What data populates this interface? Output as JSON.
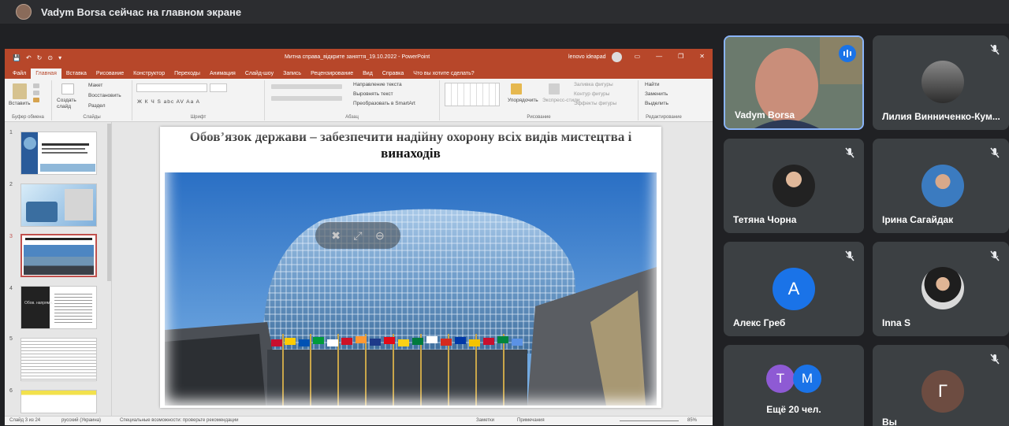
{
  "header": {
    "presenter_status": "Vadym Borsa сейчас на главном экране"
  },
  "powerpoint": {
    "window_title": "Митна справа_відкрите заняття_19.10.2022  -  PowerPoint",
    "user": "lenovo ideapad",
    "quick_access": [
      "💾",
      "↶",
      "↻",
      "⊙",
      "▾"
    ],
    "window_buttons": [
      "▭",
      "—",
      "❐",
      "✕"
    ],
    "tabs": [
      "Файл",
      "Главная",
      "Вставка",
      "Рисование",
      "Конструктор",
      "Переходы",
      "Анимация",
      "Слайд-шоу",
      "Запись",
      "Рецензирование",
      "Вид",
      "Справка"
    ],
    "tell_me": "Что вы хотите сделать?",
    "ribbon": {
      "paste": "Вставить",
      "new_slide": "Создать слайд",
      "layout": "Макет",
      "reset": "Восстановить",
      "section": "Раздел",
      "text_direction": "Направление текста",
      "align_text": "Выровнять текст",
      "smartart": "Преобразовать в SmartArt",
      "arrange": "Упорядочить",
      "quick_styles": "Экспресс-стили",
      "shape_fill": "Заливка фигуры",
      "shape_outline": "Контур фигуры",
      "shape_effects": "Эффекты фигуры",
      "find": "Найти",
      "replace": "Заменить",
      "select": "Выделить",
      "font_buttons": "Ж  К  Ч  S  abc  AV  Aa  A",
      "groups": {
        "clipboard": "Буфер обмена",
        "slides": "Слайды",
        "font": "Шрифт",
        "paragraph": "Абзац",
        "drawing": "Рисование",
        "editing": "Редактирование"
      }
    },
    "thumbnails": [
      "1",
      "2",
      "3",
      "4",
      "5",
      "6"
    ],
    "thumb4_text": "Обов. напрями...",
    "slide_title": "Обов’язок держави – забезпечити надійну охорону всіх видів мистецтва і винаходів",
    "status": {
      "slide_of": "Слайд 3 из 24",
      "language": "русский (Украина)",
      "accessibility": "Специальные возможности: проверьте рекомендации",
      "notes": "Заметки",
      "comments": "Примечания",
      "zoom": "85%"
    }
  },
  "participants": [
    {
      "name": "Vadym Borsa",
      "speaking": true
    },
    {
      "name": "Лилия Винниченко-Кум...",
      "muted": true
    },
    {
      "name": "Тетяна Чорна",
      "muted": true
    },
    {
      "name": "Ірина Сагайдак",
      "muted": true
    },
    {
      "name": "Алекс Греб",
      "muted": true,
      "initial": "А",
      "color": "#1a73e8"
    },
    {
      "name": "Inna S",
      "muted": true
    },
    {
      "name": "Ещё 20 чел.",
      "initials": [
        "Т",
        "М"
      ],
      "colors": [
        "#8e5ad4",
        "#1a73e8"
      ]
    },
    {
      "name": "Вы",
      "muted": true,
      "initial": "Г",
      "color": "#6d4c41"
    }
  ],
  "colors": {
    "powerpoint_accent": "#b7472a",
    "meet_bg": "#202124",
    "tile_bg": "#3c4043",
    "active_border": "#8ab4f8"
  }
}
